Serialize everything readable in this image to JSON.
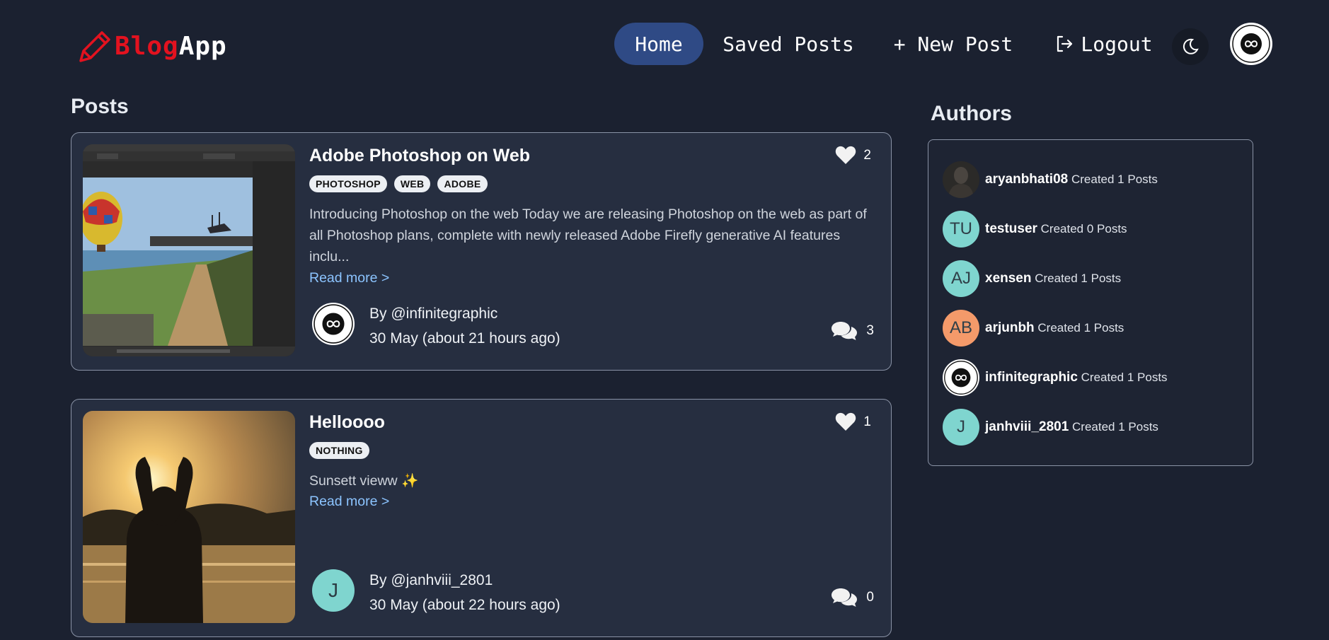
{
  "brand": {
    "part1": "Blog",
    "part2": "App",
    "accent": "#e3121f"
  },
  "nav": {
    "home": "Home",
    "saved": "Saved Posts",
    "new_post": "+ New Post",
    "logout": "Logout",
    "active": "Home",
    "active_color": "#2f4a85"
  },
  "posts_heading": "Posts",
  "authors_heading": "Authors",
  "posts": [
    {
      "title": "Adobe Photoshop on Web",
      "likes": "2",
      "tags": [
        "PHOTOSHOP",
        "WEB",
        "ADOBE"
      ],
      "excerpt": "Introducing Photoshop on the web Today we are releasing Photoshop on the web as part of all Photoshop plans, complete with newly released Adobe Firefly generative AI features inclu...",
      "read_more": "Read more >",
      "author": "By @infinitegraphic",
      "date": "30 May (about 21 hours ago)",
      "comments": "3"
    },
    {
      "title": "Helloooo",
      "likes": "1",
      "tags": [
        "NOTHING"
      ],
      "excerpt": "Sunsett vieww ✨",
      "read_more": "Read more >",
      "author_initial": "J",
      "author": "By @janhviii_2801",
      "date": "30 May (about 22 hours ago)",
      "comments": "0"
    }
  ],
  "authors": [
    {
      "name": "aryanbhati08",
      "count": "Created 1 Posts"
    },
    {
      "initials": "TU",
      "name": "testuser",
      "count": "Created 0 Posts"
    },
    {
      "initials": "AJ",
      "name": "xensen",
      "count": "Created 1 Posts"
    },
    {
      "initials": "AB",
      "name": "arjunbh",
      "count": "Created 1 Posts"
    },
    {
      "name": "infinitegraphic",
      "count": "Created 1 Posts"
    },
    {
      "initials": "J",
      "name": "janhviii_2801",
      "count": "Created 1 Posts"
    }
  ]
}
